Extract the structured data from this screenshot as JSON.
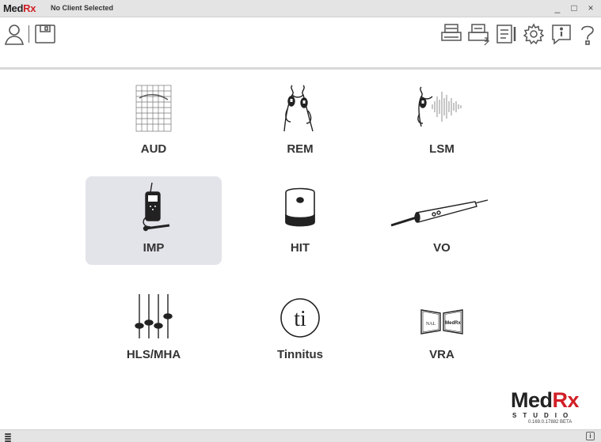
{
  "titlebar": {
    "logo_med": "Med",
    "logo_rx": "Rx",
    "client_status": "No Client Selected",
    "minimize": "_",
    "maximize": "□",
    "close": "×"
  },
  "toolbar": {
    "left_icons": [
      "client-icon",
      "save-icon"
    ],
    "right_icons": [
      "print-icon",
      "print-report-icon",
      "report-icon",
      "settings-icon",
      "info-icon",
      "help-icon"
    ]
  },
  "modules": [
    {
      "id": "aud",
      "label": "AUD",
      "icon": "audiogram-icon",
      "selected": false
    },
    {
      "id": "rem",
      "label": "REM",
      "icon": "probe-tubes-icon",
      "selected": false
    },
    {
      "id": "lsm",
      "label": "LSM",
      "icon": "live-speech-icon",
      "selected": false
    },
    {
      "id": "imp",
      "label": "IMP",
      "icon": "tympanometer-icon",
      "selected": true
    },
    {
      "id": "hit",
      "label": "HIT",
      "icon": "test-box-icon",
      "selected": false
    },
    {
      "id": "vo",
      "label": "VO",
      "icon": "otoscope-icon",
      "selected": false
    },
    {
      "id": "hls",
      "label": "HLS/MHA",
      "icon": "sliders-icon",
      "selected": false
    },
    {
      "id": "tinnitus",
      "label": "Tinnitus",
      "icon": "ti-icon",
      "selected": false
    },
    {
      "id": "vra",
      "label": "VRA",
      "icon": "vra-icon",
      "selected": false
    }
  ],
  "vra_icon_text": {
    "left": "NAL",
    "right": "MedRx"
  },
  "tinnitus_icon_text": "ti",
  "brand": {
    "med": "Med",
    "rx": "Rx",
    "studio": "STUDIO",
    "version": "0.169.0.17882 BETA"
  },
  "statusbar": {
    "info_label": "i"
  },
  "colors": {
    "brand_red": "#d11f26",
    "selected_tile": "#e3e3ea",
    "chrome": "#e4e4e4"
  }
}
